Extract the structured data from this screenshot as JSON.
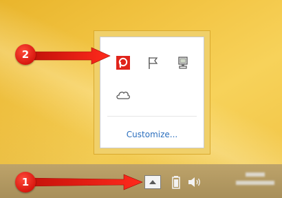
{
  "flyout": {
    "customize_label": "Customize...",
    "icons": [
      "app-logo-icon",
      "flag-icon",
      "network-icon",
      "onedrive-cloud-icon"
    ]
  },
  "taskbar": {
    "show_hidden_icon": "chevron-up-icon",
    "tray_icons": [
      "battery-icon",
      "speaker-icon"
    ]
  },
  "annotations": {
    "badge_1": "1",
    "badge_2": "2"
  },
  "colors": {
    "badge": "#d8180f",
    "link": "#2a6ebd",
    "taskbar": "#b39a63"
  }
}
